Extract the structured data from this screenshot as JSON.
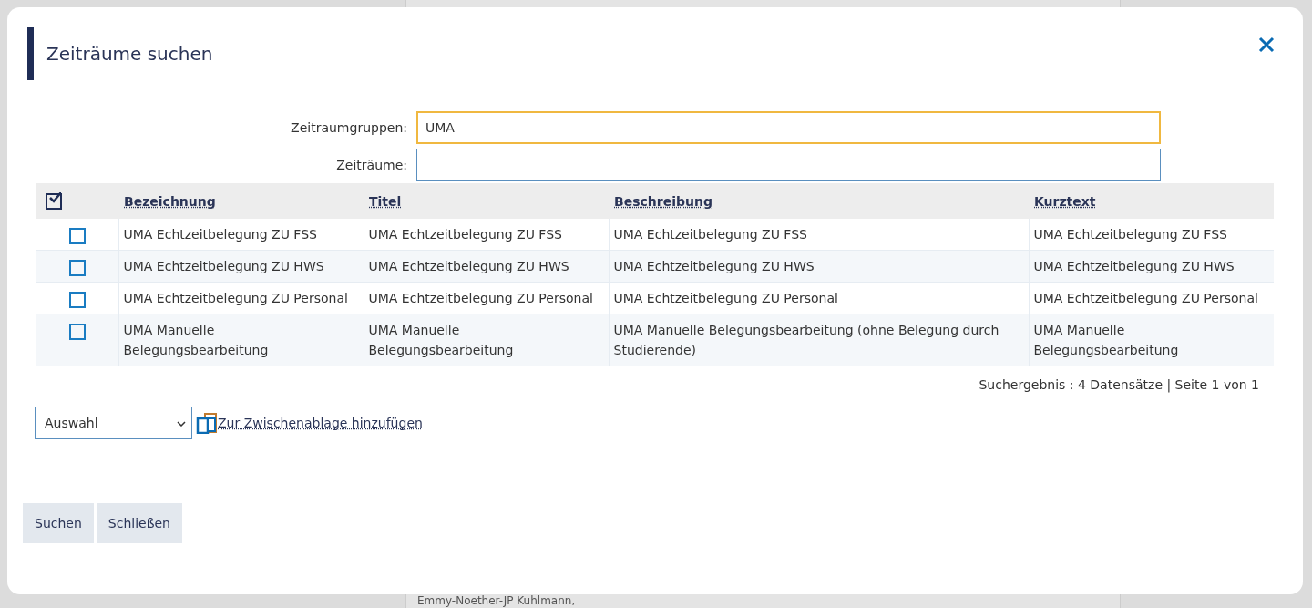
{
  "background": {
    "bottom_text": "Emmy-Noether-JP Kuhlmann,"
  },
  "dialog": {
    "title": "Zeiträume suchen",
    "fields": [
      {
        "label": "Zeitraumgruppen:",
        "value": "UMA",
        "focused": true
      },
      {
        "label": "Zeiträume:",
        "focused": false
      }
    ],
    "table": {
      "select_all_checked": true,
      "columns": [
        "Bezeichnung",
        "Titel",
        "Beschreibung",
        "Kurztext"
      ],
      "rows": [
        {
          "checked": false,
          "cells": [
            "UMA Echtzeitbelegung ZU FSS",
            "UMA Echtzeitbelegung ZU FSS",
            "UMA Echtzeitbelegung ZU FSS",
            "UMA Echtzeitbelegung ZU FSS"
          ]
        },
        {
          "checked": false,
          "cells": [
            "UMA Echtzeitbelegung ZU HWS",
            "UMA Echtzeitbelegung ZU HWS",
            "UMA Echtzeitbelegung ZU HWS",
            "UMA Echtzeitbelegung ZU HWS"
          ]
        },
        {
          "checked": false,
          "cells": [
            "UMA Echtzeitbelegung ZU Personal",
            "UMA Echtzeitbelegung ZU Personal",
            "UMA Echtzeitbelegung ZU Personal",
            "UMA Echtzeitbelegung ZU Personal"
          ]
        },
        {
          "checked": false,
          "cells": [
            "UMA Manuelle Belegungsbearbeitung",
            "UMA Manuelle Belegungsbearbeitung",
            "UMA Manuelle Belegungsbearbeitung (ohne Belegung durch Studierende)",
            "UMA Manuelle Belegungsbearbeitung"
          ]
        }
      ],
      "result_info": "Suchergebnis : 4 Datensätze | Seite 1 von 1"
    },
    "action_select": "Auswahl",
    "clipboard_link": "Zur Zwischenablage hinzufügen",
    "buttons": [
      "Suchen",
      "Schließen"
    ]
  }
}
